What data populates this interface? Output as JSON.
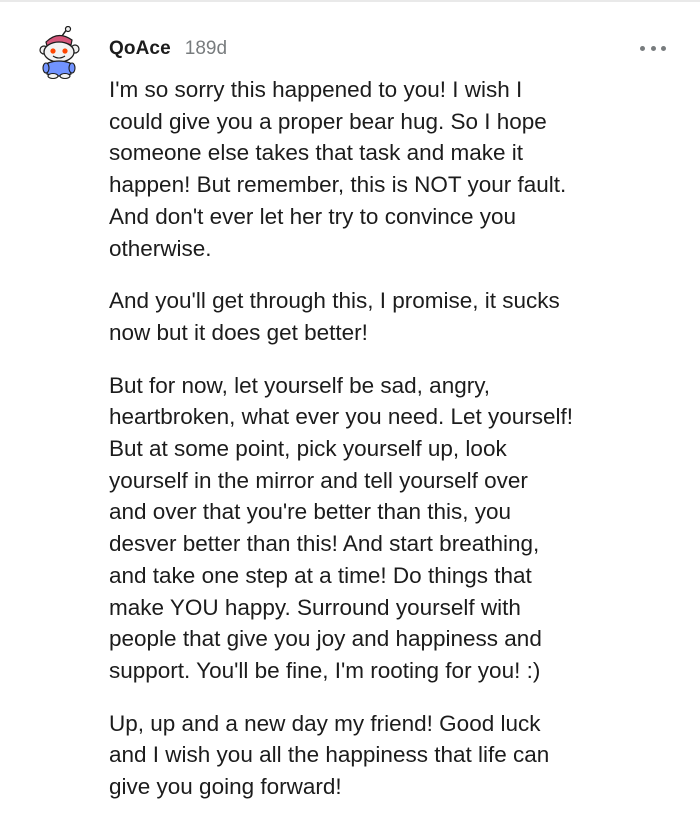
{
  "comment": {
    "username": "QoAce",
    "timestamp": "189d",
    "avatar_icon": "reddit-snoo-avatar-icon",
    "more_icon": "more-options-icon",
    "paragraphs": [
      "I'm so sorry this happened to you! I wish I\ncould give you a proper bear hug. So I hope\nsomeone else takes that task and make it\nhappen! But remember, this is NOT your fault.\nAnd don't ever let her try to convince you\notherwise.",
      "And you'll get through this, I promise, it sucks\nnow but it does get better!",
      "But for now, let yourself be sad, angry,\nheartbroken, what ever you need. Let yourself!\nBut at some point, pick yourself up, look\nyourself in the mirror and tell yourself over\nand over that you're better than this, you\ndesver better than this! And start breathing,\nand take one step at a time! Do things that\nmake YOU happy. Surround yourself with\npeople that give you joy and happiness and\nsupport. You'll be fine, I'm rooting for you! :)",
      "Up, up and a new day my friend! Good luck\nand I wish you all the happiness that life can\ngive you going forward!"
    ]
  },
  "colors": {
    "text": "#1c1c1c",
    "meta": "#787c7e",
    "avatar_face": "#f2f2f2",
    "avatar_accent": "#ff4500",
    "avatar_hat": "#d6567a",
    "avatar_shirt": "#7193ff"
  }
}
